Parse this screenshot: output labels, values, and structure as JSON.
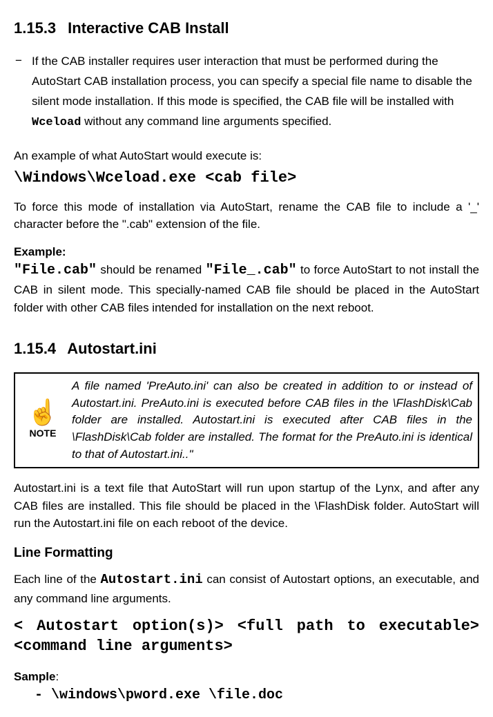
{
  "s1": {
    "num": "1.15.3",
    "title": "Interactive CAB Install",
    "bullet_dash": "−",
    "bullet_text_1": "If the CAB installer requires user interaction that must be performed during the AutoStart CAB installation process, you can specify a special file name to disable the silent mode installation. If this mode is specified, the CAB file will be installed with ",
    "wceload": "Wceload",
    "bullet_text_2": " without any command line arguments specified.",
    "example_intro": "An example of what AutoStart would execute is:",
    "example_cmd": "\\Windows\\Wceload.exe <cab file>",
    "force_text": "To force this mode of installation via AutoStart, rename the CAB file to include a '_' character before the \".cab\" extension of the file.",
    "example_label": "Example:",
    "file_cab": "\"File.cab\"",
    "rename_mid": " should be renamed ",
    "file_cab_new": "\"File_.cab\"",
    "rename_end": " to force AutoStart to not install the CAB in silent mode. This specially-named CAB file should be placed in the AutoStart folder with other CAB files intended for installation on the next reboot."
  },
  "s2": {
    "num": "1.15.4",
    "title": "Autostart.ini",
    "note_label": "NOTE",
    "note_text": "A file named 'PreAuto.ini' can also be created in addition to or instead of Autostart.ini. PreAuto.ini is executed before CAB files in the \\FlashDisk\\Cab folder are installed. Autostart.ini is executed after CAB files in the \\FlashDisk\\Cab folder are installed. The format for the PreAuto.ini is identical to that of Autostart.ini..\"",
    "body": "Autostart.ini is a text file that AutoStart will run upon startup of the Lynx, and after any CAB files are installed. This file should be placed in the \\FlashDisk folder. AutoStart will run the Autostart.ini file on each reboot of the device.",
    "lf_heading": "Line Formatting",
    "lf_text_1": "Each line of the ",
    "autostart_ini": "Autostart.ini",
    "lf_text_2": " can consist of Autostart options, an executable, and any command line arguments.",
    "syntax": "< Autostart option(s)> <full path to executable> <command line arguments>",
    "sample_label": "Sample",
    "sample_colon": ":",
    "sample_line": "- \\windows\\pword.exe \\file.doc"
  }
}
